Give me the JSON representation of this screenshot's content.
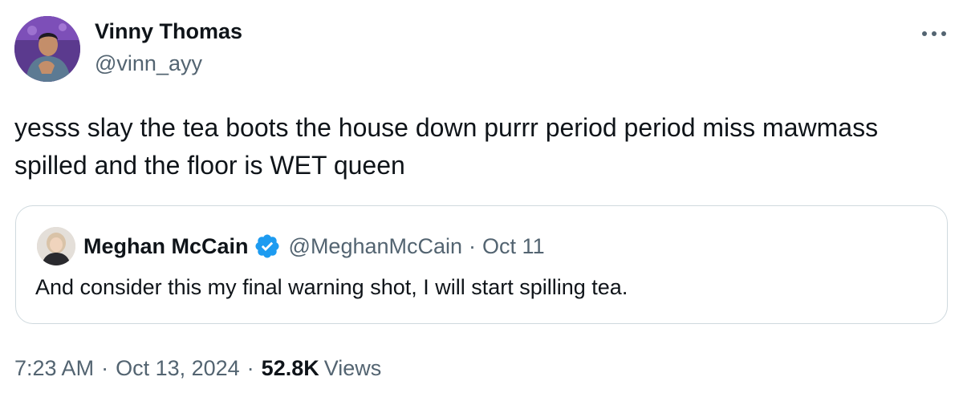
{
  "author": {
    "name": "Vinny Thomas",
    "handle": "@vinn_ayy"
  },
  "more_icon": "more-dots-icon",
  "tweet": {
    "text": "yesss slay the tea boots the house down purrr period period miss mawmass spilled and the floor is WET queen"
  },
  "quoted": {
    "name": "Meghan McCain",
    "verified_icon": "verified-badge-icon",
    "verified_color": "#1d9bf0",
    "handle": "@MeghanMcCain",
    "separator": "·",
    "date": "Oct 11",
    "text": "And consider this my final warning shot, I will start spilling tea."
  },
  "meta": {
    "time": "7:23 AM",
    "separator": "·",
    "date": "Oct 13, 2024",
    "views_count": "52.8K",
    "views_label": "Views"
  },
  "colors": {
    "text": "#0f1419",
    "secondary": "#536471",
    "border": "#cfd9de"
  }
}
